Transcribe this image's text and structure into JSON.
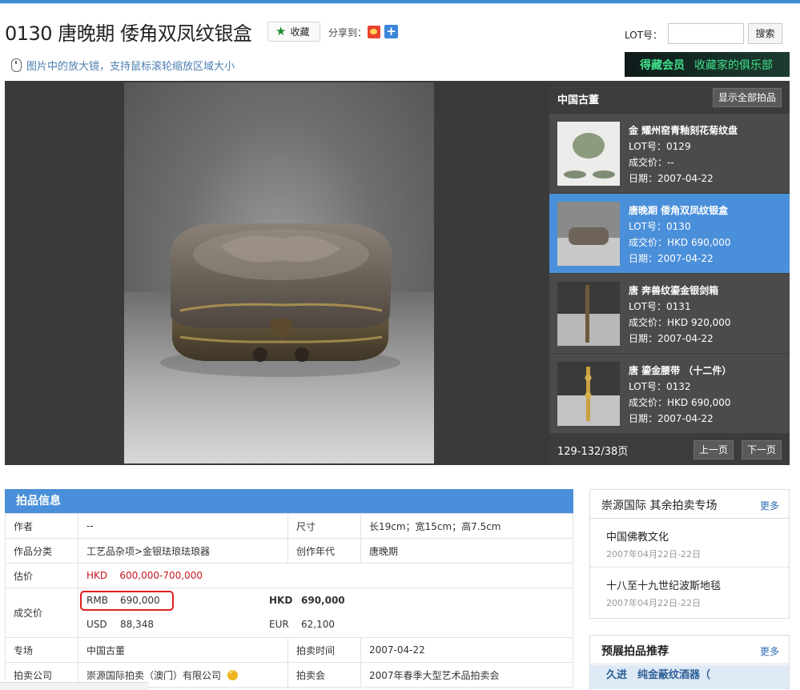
{
  "header": {
    "title": "0130 唐晚期 倭角双凤纹银盒",
    "favorite_label": "收藏",
    "share_label": "分享到：",
    "lot_label": "LOT号：",
    "lot_input_value": "",
    "search_label": "搜索",
    "zoom_tip": "图片中的放大镜，支持鼠标滚轮缩放区域大小",
    "member_title": "得藏会员",
    "member_subtitle": "收藏家的俱乐部"
  },
  "colors": {
    "accent": "#4a8fd9",
    "price_red": "#c8181f",
    "member_green": "#3fe08a",
    "highlight_box": "#e02020"
  },
  "sidebar": {
    "title": "中国古董",
    "show_all_label": "显示全部拍品",
    "items": [
      {
        "name": "金 耀州窑青釉刻花菊纹盘",
        "lot": "LOT号：0129",
        "price": "成交价：--",
        "date": "日期：2007-04-22",
        "active": false
      },
      {
        "name": "唐晚期 倭角双凤纹银盒",
        "lot": "LOT号：0130",
        "price": "成交价：HKD 690,000",
        "date": "日期：2007-04-22",
        "active": true
      },
      {
        "name": "唐 奔兽纹鎏金银剑箱",
        "lot": "LOT号：0131",
        "price": "成交价：HKD 920,000",
        "date": "日期：2007-04-22",
        "active": false
      },
      {
        "name": "唐 鎏金腰带 （十二件）",
        "lot": "LOT号：0132",
        "price": "成交价：HKD 690,000",
        "date": "日期：2007-04-22",
        "active": false
      }
    ],
    "pages": "129-132/38页",
    "prev_label": "上一页",
    "next_label": "下一页"
  },
  "info": {
    "heading": "拍品信息",
    "author_label": "作者",
    "author_value": "--",
    "size_label": "尺寸",
    "size_value": "长19cm；宽15cm；高7.5cm",
    "category_label": "作品分类",
    "category_value": "工艺品杂项>金银珐琅珐琅器",
    "era_label": "创作年代",
    "era_value": "唐晚期",
    "estimate_label": "估价",
    "estimate_currency": "HKD",
    "estimate_value": "600,000-700,000",
    "deal_label": "成交价",
    "deal": {
      "rmb_cur": "RMB",
      "rmb_val": "690,000",
      "hkd_cur": "HKD",
      "hkd_val": "690,000",
      "usd_cur": "USD",
      "usd_val": "88,348",
      "eur_cur": "EUR",
      "eur_val": "62,100"
    },
    "session_label": "专场",
    "session_value": "中国古董",
    "time_label": "拍卖时间",
    "time_value": "2007-04-22",
    "company_label": "拍卖公司",
    "company_value": "崇源国际拍卖（澳门）有限公司",
    "auction_label": "拍卖会",
    "auction_value": "2007年春季大型艺术品拍卖会"
  },
  "other_sessions": {
    "title": "崇源国际  其余拍卖专场",
    "more": "更多",
    "items": [
      {
        "name": "中国佛教文化",
        "date": "2007年04月22日-22日"
      },
      {
        "name": "十八至十九世纪波斯地毯",
        "date": "2007年04月22日-22日"
      }
    ]
  },
  "preview": {
    "title": "预展拍品推荐",
    "more": "更多",
    "first_item": "久进　纯金蔽纹酒器（"
  }
}
